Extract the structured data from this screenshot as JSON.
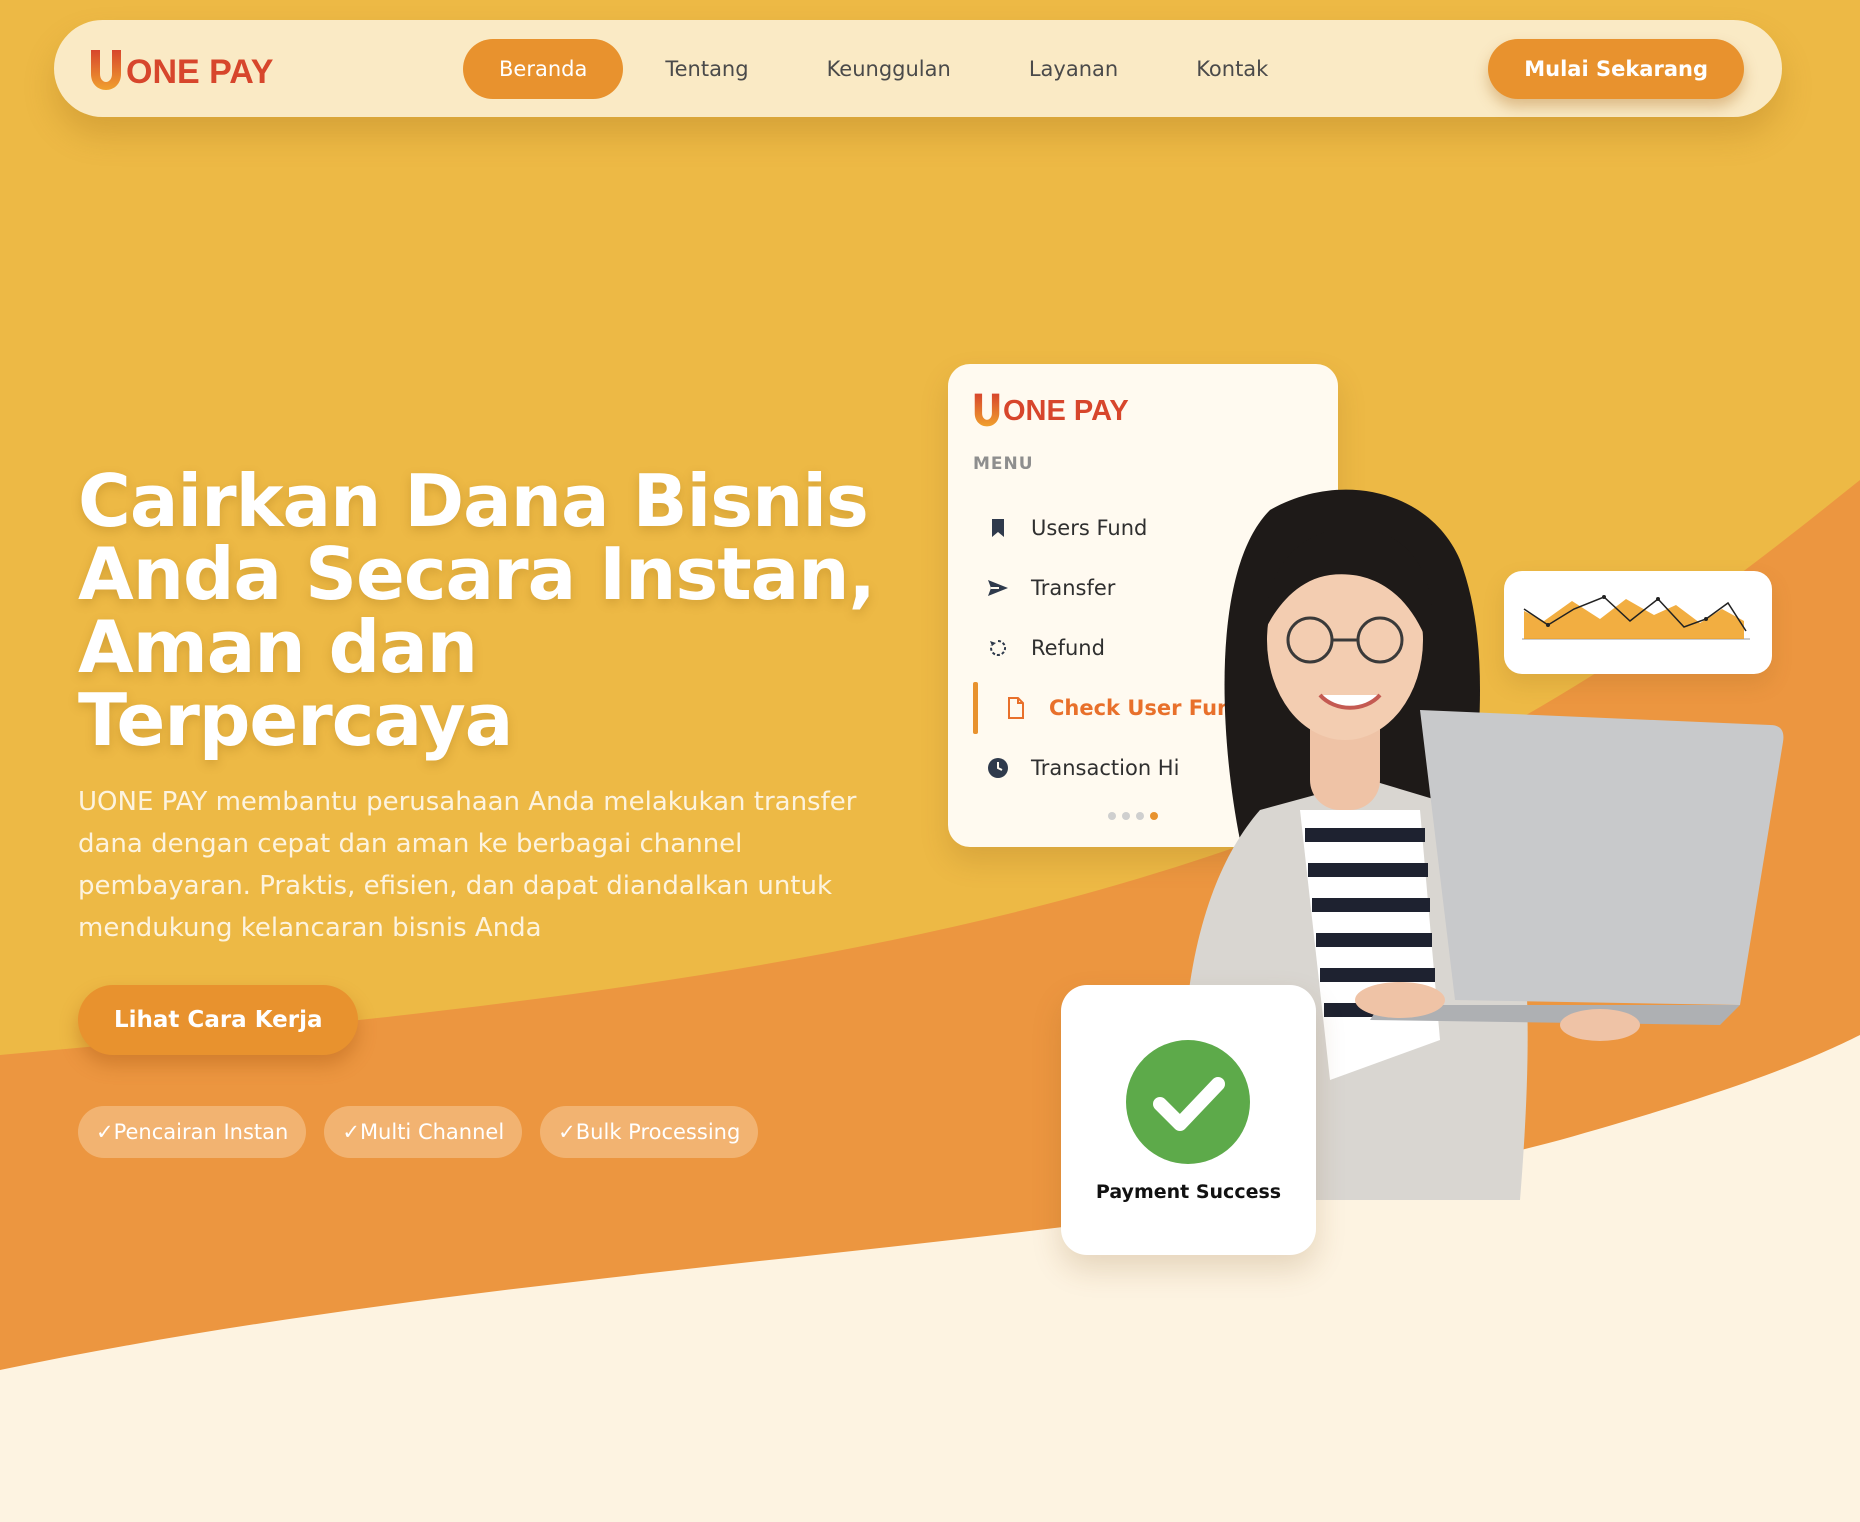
{
  "colors": {
    "background_yellow": "#EDB945",
    "wave_orange": "#EC9640",
    "cream": "#FDF3E1",
    "accent": "#E8922E",
    "brand_red": "#D7462C",
    "success_green": "#5DAA4A"
  },
  "nav": {
    "brand": "ONE PAY",
    "links": [
      "Beranda",
      "Tentang",
      "Keunggulan",
      "Layanan",
      "Kontak"
    ],
    "active_index": 0,
    "cta": "Mulai Sekarang"
  },
  "hero": {
    "title_lines": [
      "Cairkan Dana Bisnis",
      "Anda Secara Instan,",
      "Aman dan",
      "Terpercaya"
    ],
    "description": "UONE PAY membantu perusahaan Anda melakukan transfer dana dengan cepat dan aman ke berbagai channel pembayaran. Praktis, efisien, dan dapat diandalkan untuk mendukung kelancaran bisnis Anda",
    "cta": "Lihat Cara Kerja",
    "badges": [
      "✓Pencairan Instan",
      "✓Multi Channel",
      "✓Bulk Processing"
    ]
  },
  "dashboard": {
    "brand": "ONE PAY",
    "menu_heading": "MENU",
    "menu_items": [
      {
        "label": "Users Fund",
        "icon": "bookmark-icon"
      },
      {
        "label": "Transfer",
        "icon": "send-icon"
      },
      {
        "label": "Refund",
        "icon": "refresh-icon"
      },
      {
        "label": "Check User Fund",
        "icon": "document-icon"
      },
      {
        "label": "Transaction Hi",
        "icon": "clock-icon"
      }
    ],
    "active_menu_index": 3,
    "carousel_active_dot": 3
  },
  "payment": {
    "label": "Payment Success",
    "icon": "check-circle-icon"
  }
}
